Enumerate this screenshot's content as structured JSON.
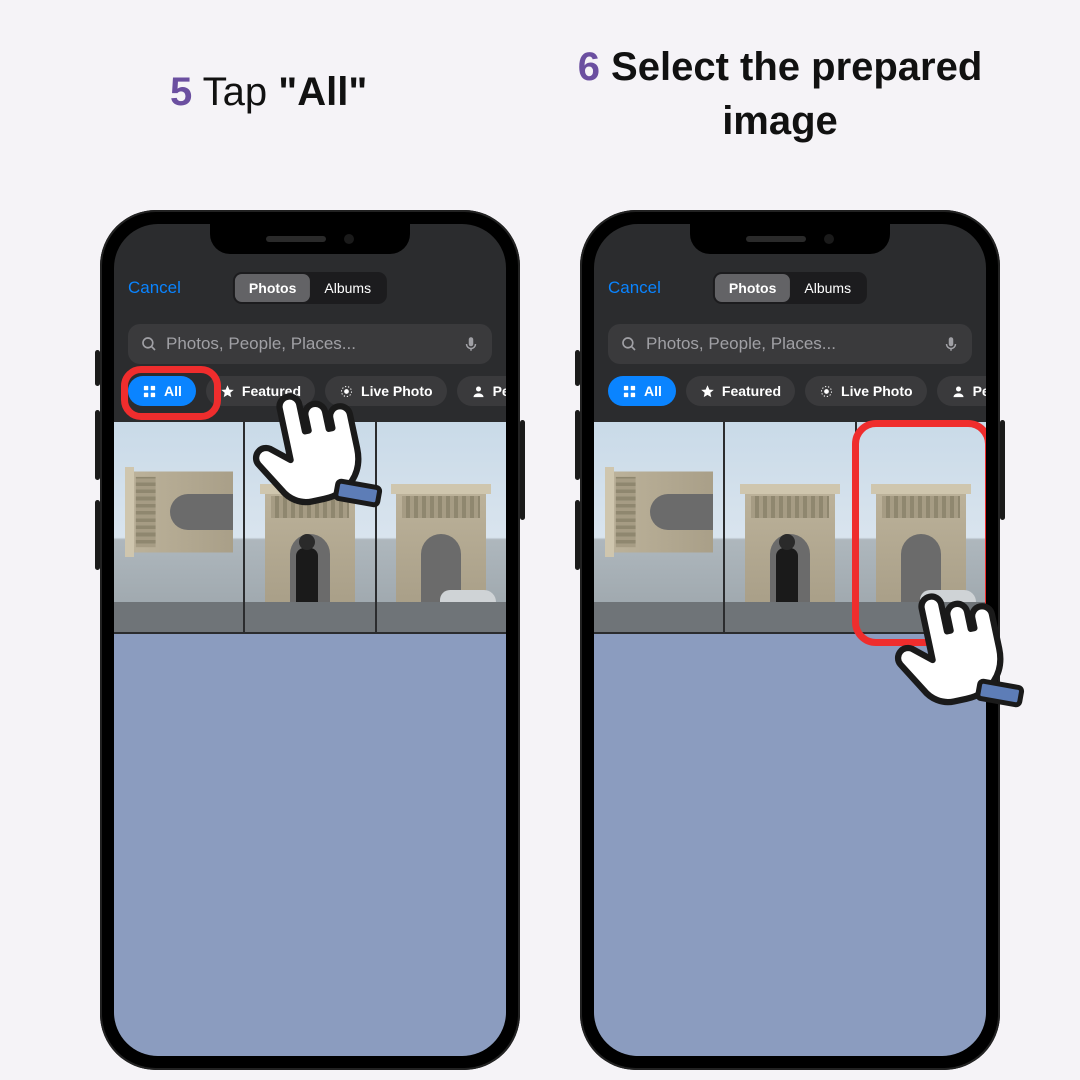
{
  "steps": {
    "s5": {
      "num": "5",
      "pre": " Tap ",
      "quote_open": "\"",
      "word": "All",
      "quote_close": "\""
    },
    "s6": {
      "num": "6",
      "text": " Select the prepared image"
    }
  },
  "picker": {
    "cancel": "Cancel",
    "tabs": {
      "photos": "Photos",
      "albums": "Albums"
    },
    "search": {
      "placeholder": "Photos, People, Places..."
    },
    "chips": {
      "all": "All",
      "featured": "Featured",
      "live": "Live Photo",
      "people": "People"
    }
  }
}
